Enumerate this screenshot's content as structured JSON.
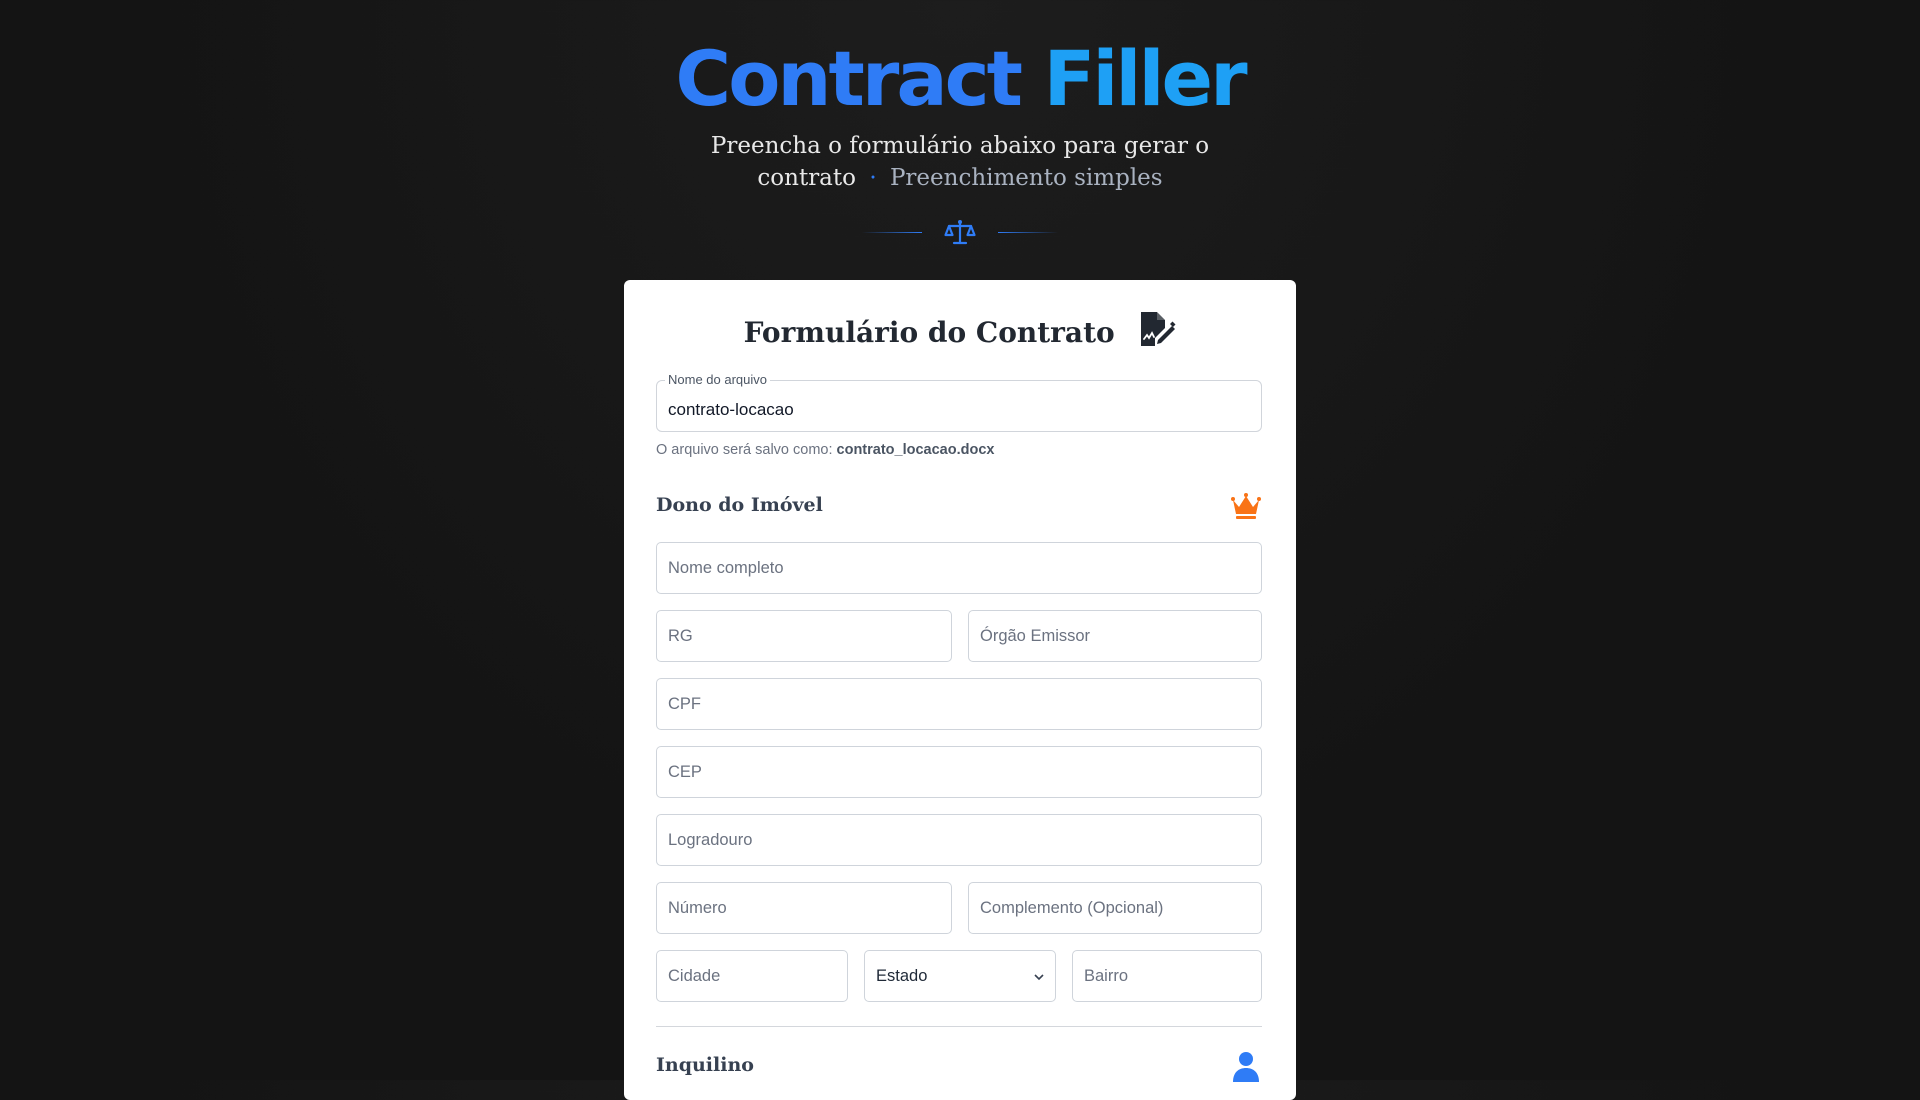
{
  "header": {
    "title_part1": "Contract",
    "title_part2": "Filler",
    "subtitle_main": "Preencha o formulário abaixo para gerar o contrato",
    "subtitle_dot": "·",
    "subtitle_secondary": "Preenchimento simples",
    "divider_icon": "scale-icon",
    "accent_color": "#2f7cf6"
  },
  "form": {
    "title": "Formulário do Contrato",
    "title_icon": "document-signature-icon",
    "file_name": {
      "label": "Nome do arquivo",
      "value": "contrato-locacao"
    },
    "hint_prefix": "O arquivo será salvo como:",
    "hint_filename": "contrato_locacao.docx",
    "owner_section": {
      "title": "Dono do Imóvel",
      "icon": "crown-icon",
      "icon_color": "#f97316",
      "fields": {
        "full_name": "Nome completo",
        "rg": "RG",
        "issuer": "Órgão Emissor",
        "cpf": "CPF",
        "cep": "CEP",
        "street": "Logradouro",
        "number": "Número",
        "complement": "Complemento (Opcional)",
        "city": "Cidade",
        "state": "Estado",
        "neighborhood": "Bairro"
      }
    },
    "tenant_section": {
      "title": "Inquilino",
      "icon": "user-icon",
      "icon_color": "#2f7cf6"
    }
  }
}
